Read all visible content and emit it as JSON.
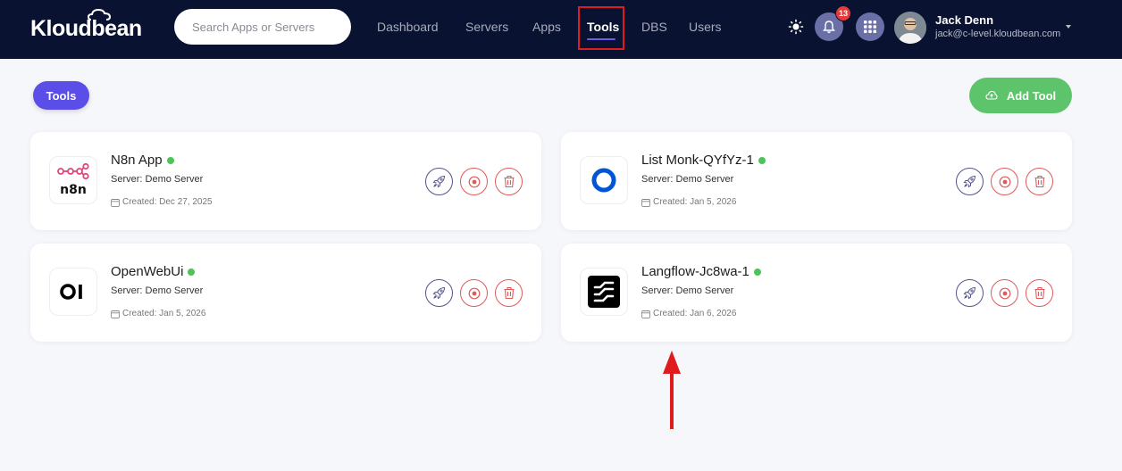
{
  "header": {
    "logo": "Kloudbean",
    "search_placeholder": "Search Apps or Servers",
    "nav": [
      "Dashboard",
      "Servers",
      "Apps",
      "Tools",
      "DBS",
      "Users"
    ],
    "active_nav": "Tools",
    "notification_count": "13",
    "user": {
      "name": "Jack Denn",
      "email": "jack@c-level.kloudbean.com"
    }
  },
  "toolbar": {
    "tab_label": "Tools",
    "add_label": "Add Tool"
  },
  "tools": [
    {
      "name": "N8n App",
      "server": "Server: Demo Server",
      "created": "Created: Dec 27, 2025",
      "logo": "n8n-logo",
      "status_color": "#4cc45a"
    },
    {
      "name": "List Monk-QYfYz-1",
      "server": "Server: Demo Server",
      "created": "Created: Jan 5, 2026",
      "logo": "listmonk-logo",
      "status_color": "#4cc45a"
    },
    {
      "name": "OpenWebUi",
      "server": "Server: Demo Server",
      "created": "Created: Jan 5, 2026",
      "logo": "openwebui-logo",
      "status_color": "#4cc45a"
    },
    {
      "name": "Langflow-Jc8wa-1",
      "server": "Server: Demo Server",
      "created": "Created: Jan 6, 2026",
      "logo": "langflow-logo",
      "status_color": "#4cc45a"
    }
  ],
  "colors": {
    "header_bg": "#091230",
    "accent": "#5b4de8",
    "add_button": "#5dc46b",
    "highlight_box": "#e01b1b",
    "arrow": "#e01b1b"
  }
}
